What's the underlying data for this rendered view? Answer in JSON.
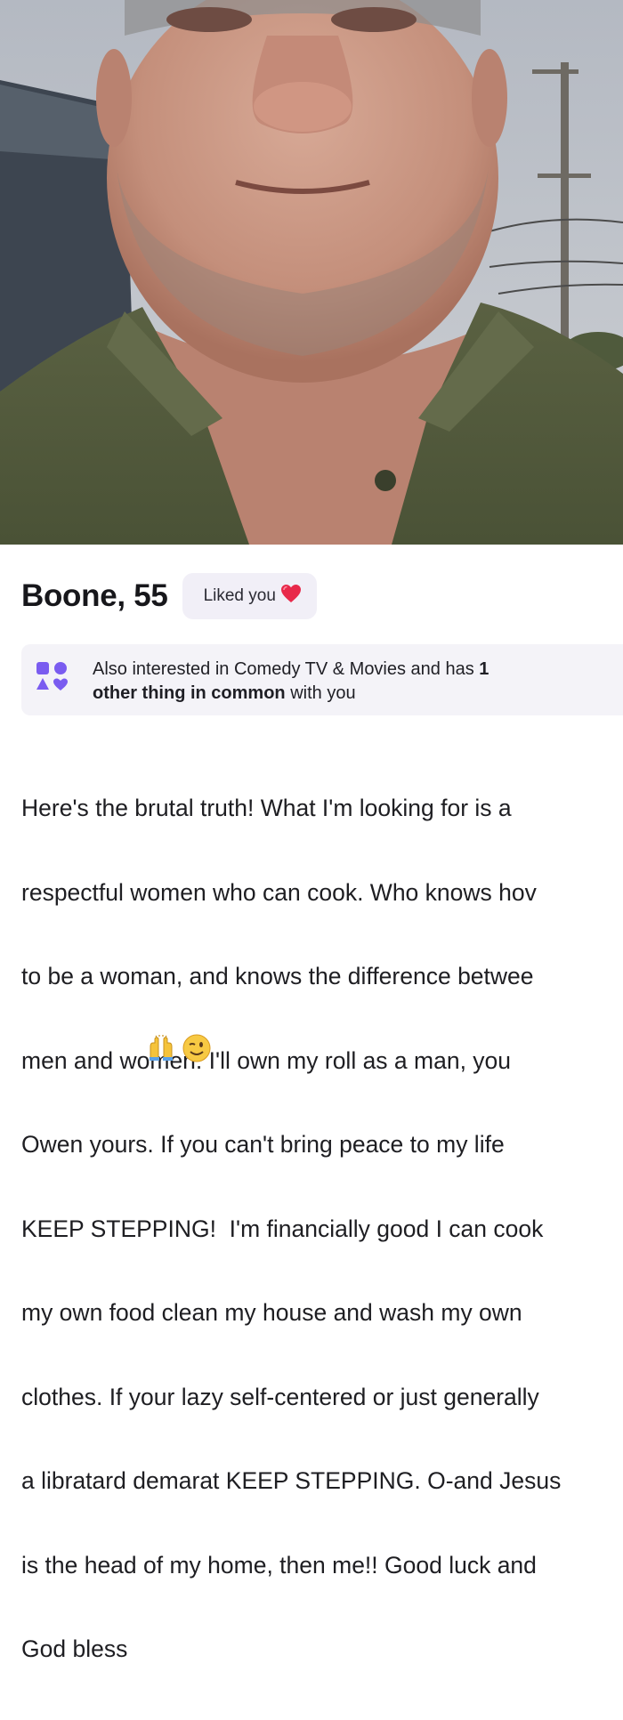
{
  "profile": {
    "name": "Boone, 55",
    "liked_label": "Liked you",
    "interests": {
      "prefix": "Also interested in Comedy TV & Movies and has ",
      "count_bold": "1",
      "common_bold": "other thing in common",
      "suffix": " with you"
    },
    "bio_lines": [
      "Here's the brutal truth! What I'm looking for is a",
      "respectful women who can cook. Who knows hov",
      "to be a woman, and knows the difference betwee",
      "men and women. I'll own my roll as a man, you",
      "Owen yours. If you can't bring peace to my life",
      "KEEP STEPPING!  I'm financially good I can cook",
      "my own food clean my house and wash my own",
      "clothes. If your lazy self-centered or just generally",
      "a libratard demarat KEEP STEPPING. O-and Jesus",
      "is the head of my home, then me!! Good luck and",
      "God bless"
    ],
    "emojis": [
      "raising-hands-icon",
      "winking-face-icon"
    ]
  },
  "colors": {
    "accent_heart": "#e8294a",
    "badge_bg": "#f1eff7",
    "interests_icon": "#7a5cf0"
  },
  "icons": {
    "heart": "heart-icon",
    "shared_interests": "shapes-icon"
  }
}
